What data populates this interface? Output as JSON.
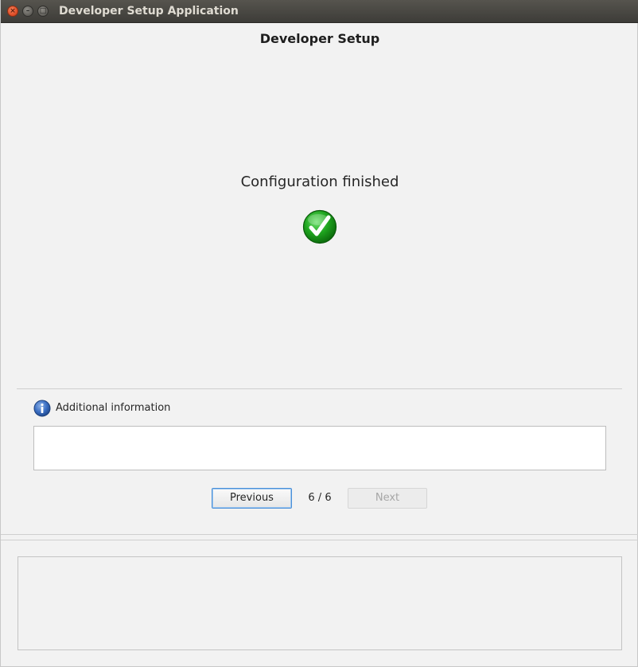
{
  "window": {
    "title": "Developer Setup Application",
    "controls": {
      "close_glyph": "×",
      "minimize_glyph": "–",
      "maximize_glyph": "□"
    }
  },
  "header": {
    "title": "Developer Setup"
  },
  "main": {
    "status_text": "Configuration finished",
    "status_icon": "check-icon",
    "accent_color": "#1e9a1e"
  },
  "info": {
    "label": "Additional information",
    "icon": "info-icon",
    "text": ""
  },
  "navigation": {
    "previous_label": "Previous",
    "next_label": "Next",
    "next_enabled": false,
    "page_indicator": "6 / 6",
    "current_page": 6,
    "total_pages": 6
  },
  "log": {
    "text": ""
  }
}
